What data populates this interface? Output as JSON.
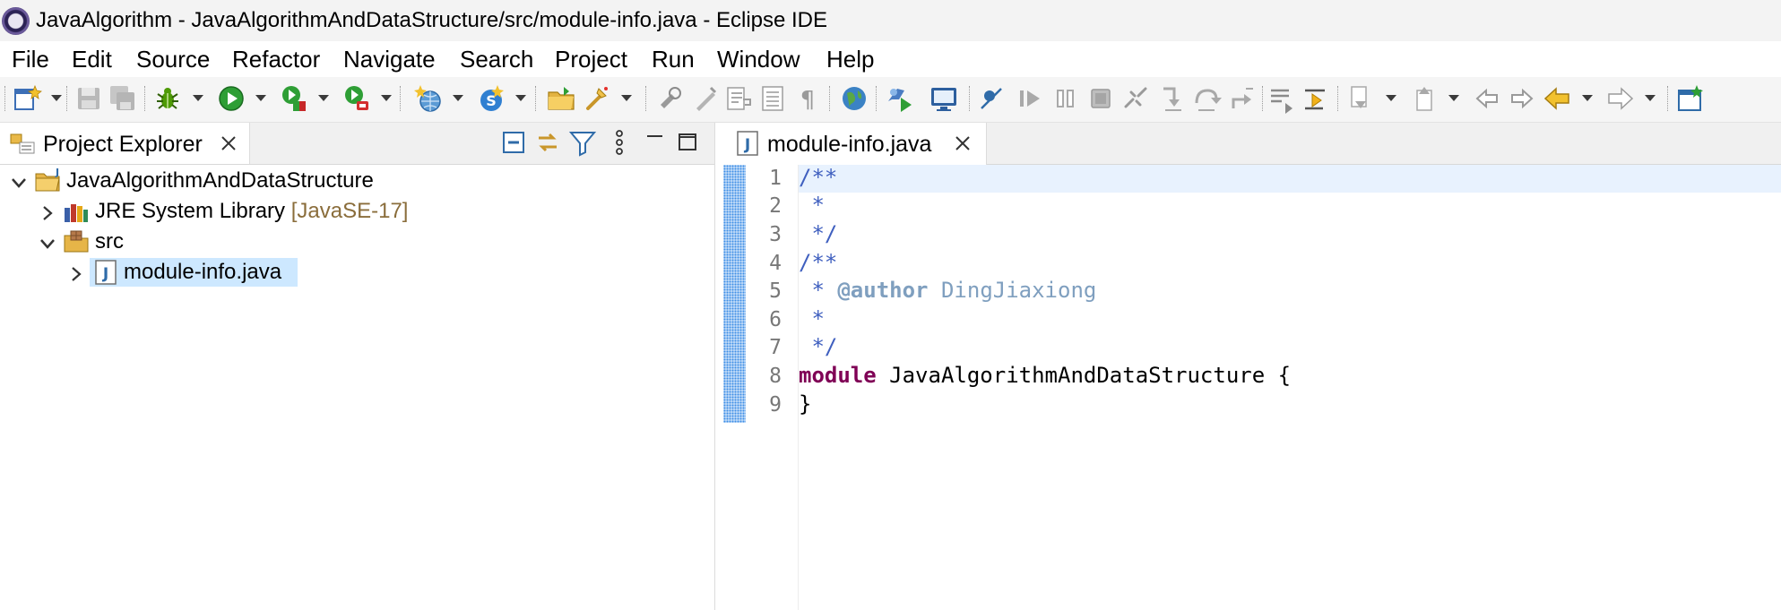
{
  "window": {
    "title": "JavaAlgorithm - JavaAlgorithmAndDataStructure/src/module-info.java - Eclipse IDE"
  },
  "menu": [
    {
      "label": "File"
    },
    {
      "label": "Edit"
    },
    {
      "label": "Source"
    },
    {
      "label": "Refactor"
    },
    {
      "label": "Navigate"
    },
    {
      "label": "Search"
    },
    {
      "label": "Project"
    },
    {
      "label": "Run"
    },
    {
      "label": "Window"
    },
    {
      "label": "Help"
    }
  ],
  "toolbar_icons": [
    "new-wizard-icon",
    "save-icon",
    "save-all-icon",
    "debug-icon",
    "run-icon",
    "coverage-icon",
    "run-last-tool-icon",
    "new-java-project-icon",
    "new-class-icon",
    "open-type-icon",
    "search-icon",
    "toggle-mark-occurrences-icon",
    "toggle-block-selection-icon",
    "show-whitespace-icon",
    "web-browser-icon",
    "run-server-icon",
    "console-icon",
    "skip-breakpoints-icon",
    "resume-icon",
    "suspend-icon",
    "terminate-icon",
    "disconnect-icon",
    "step-into-icon",
    "step-over-icon",
    "step-return-icon",
    "drop-to-frame-icon",
    "use-step-filters-icon",
    "next-annotation-icon",
    "previous-annotation-icon",
    "last-edit-location-icon",
    "back-icon",
    "forward-icon",
    "open-perspective-icon"
  ],
  "project_explorer": {
    "tab_label": "Project Explorer",
    "tree": {
      "project": "JavaAlgorithmAndDataStructure",
      "jre_label": "JRE System Library",
      "jre_decoration": "[JavaSE-17]",
      "src_label": "src",
      "file_label": "module-info.java"
    }
  },
  "editor": {
    "tab_label": "module-info.java",
    "line_numbers": [
      "1",
      "2",
      "3",
      "4",
      "5",
      "6",
      "7",
      "8",
      "9"
    ],
    "code": {
      "l1": "/**",
      "l2": " *",
      "l3": " */",
      "l4": "/**",
      "l5_prefix": " * ",
      "l5_tag": "@author",
      "l5_value": " DingJiaxiong",
      "l6": " *",
      "l7": " */",
      "l8_kw": "module",
      "l8_rest": " JavaAlgorithmAndDataStructure {",
      "l9": "}"
    }
  },
  "colors": {
    "keyword": "#7f0055",
    "javadoc": "#3f5fbf",
    "javadoc_tag": "#7f9fbf",
    "selection": "#cde8ff",
    "current_line": "#e8f2fe"
  }
}
